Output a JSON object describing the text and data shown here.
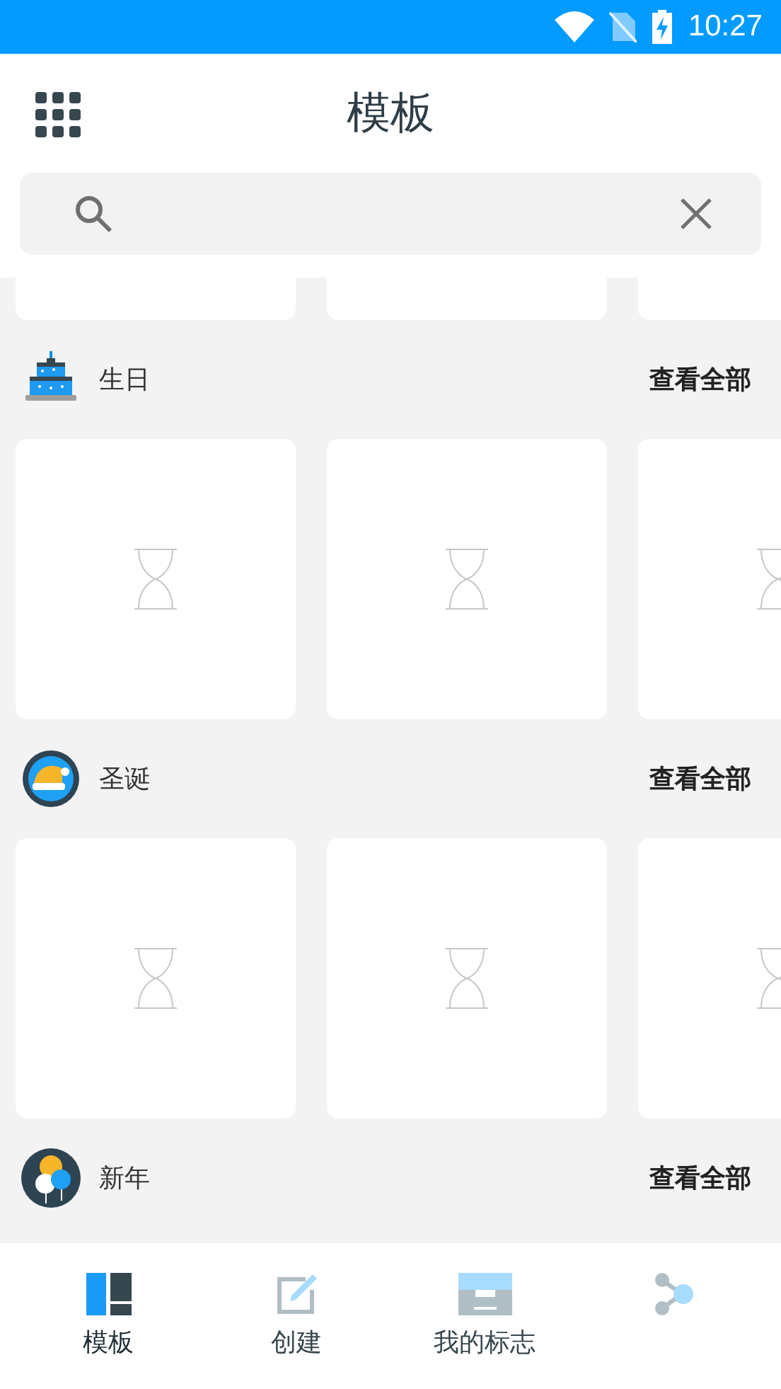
{
  "status_bar": {
    "time": "10:27"
  },
  "header": {
    "title": "模板"
  },
  "top_cards": [
    {
      "kind": "blank"
    },
    {
      "kind": "blank"
    },
    {
      "kind": "blank"
    }
  ],
  "sections": [
    {
      "kind": "cake",
      "title": "生日",
      "view_all": "查看全部",
      "cards": [
        {
          "kind": "loading"
        },
        {
          "kind": "loading"
        },
        {
          "kind": "loading"
        }
      ]
    },
    {
      "kind": "hat",
      "title": "圣诞",
      "view_all": "查看全部",
      "cards": [
        {
          "kind": "loading"
        },
        {
          "kind": "loading"
        },
        {
          "kind": "loading"
        }
      ]
    },
    {
      "kind": "balloons",
      "title": "新年",
      "view_all": "查看全部"
    }
  ],
  "nav": [
    {
      "kind": "templates",
      "label": "模板",
      "selected": true
    },
    {
      "kind": "create",
      "label": "创建",
      "selected": false
    },
    {
      "kind": "tray",
      "label": "我的标志",
      "selected": false
    },
    {
      "kind": "share",
      "selected": false
    }
  ]
}
